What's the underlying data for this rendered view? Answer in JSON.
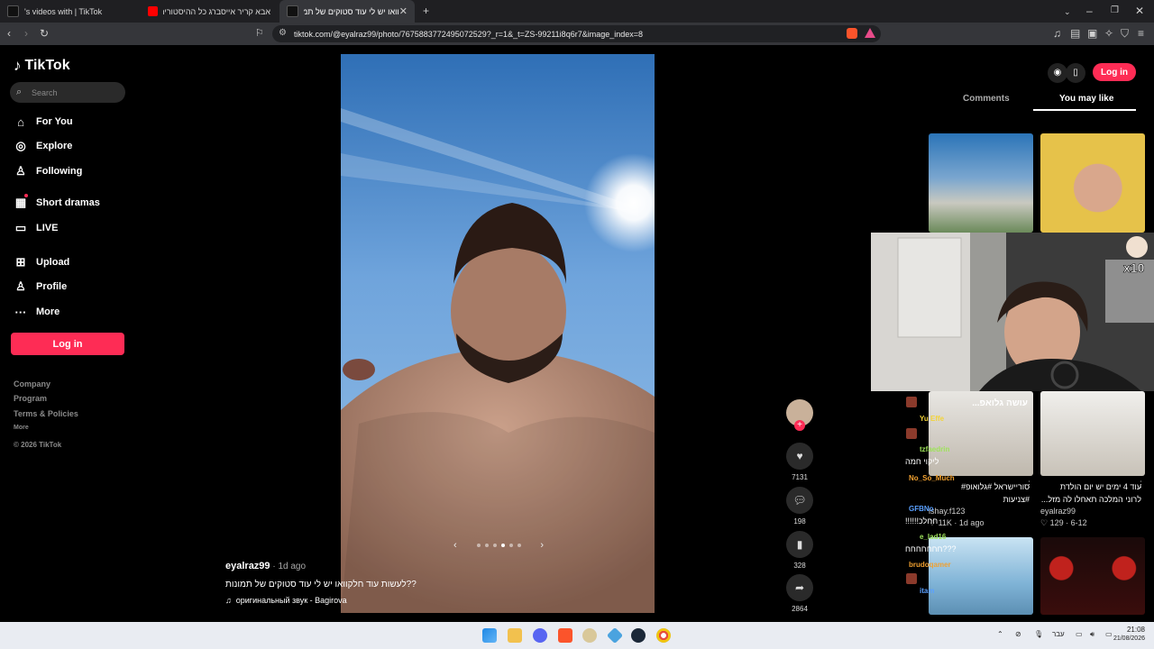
{
  "browser": {
    "tabs": [
      {
        "title": "'s videos with | TikTok",
        "active": false
      },
      {
        "title": "אבא קריר אייסברג כל ההיסטוריה (ה",
        "active": false
      },
      {
        "title": "וואו יש לי עוד סטוקים של תמונות",
        "active": true
      }
    ],
    "new_tab": "+",
    "url": "tiktok.com/@eyalraz99/photo/7675883772495072529?_r=1&_t=ZS-99211i8q6r7&image_index=8"
  },
  "sidebar": {
    "brand": "TikTok",
    "search_placeholder": "Search",
    "nav": [
      {
        "label": "For You",
        "icon": "home-icon"
      },
      {
        "label": "Explore",
        "icon": "compass-icon"
      },
      {
        "label": "Following",
        "icon": "following-icon"
      },
      {
        "label": "Short dramas",
        "icon": "drama-icon"
      },
      {
        "label": "LIVE",
        "icon": "live-icon"
      },
      {
        "label": "Upload",
        "icon": "upload-icon"
      },
      {
        "label": "Profile",
        "icon": "profile-icon"
      },
      {
        "label": "More",
        "icon": "more-icon"
      }
    ],
    "login_label": "Log in",
    "footer": {
      "company": "Company",
      "program": "Program",
      "terms": "Terms & Policies",
      "more": "More",
      "copyright": "© 2026 TikTok"
    }
  },
  "post": {
    "username": "eyalraz99",
    "time": "1d ago",
    "caption": "לעשות עוד חלקוואו יש לי עוד סטוקים של תמונות??",
    "sound": "оригинальный звук - Bagirova",
    "likes": "7131",
    "comments": "198",
    "saves": "328",
    "shares": "2864",
    "carousel_dots": 6,
    "carousel_active": 3
  },
  "header_right": {
    "login_label": "Log in"
  },
  "right_panel": {
    "tabs": [
      "Comments",
      "You may like"
    ],
    "active_tab": "You may like",
    "cards": [
      {
        "overlay": "עושה גלואפ...",
        "caption": "סוריישראל #גלואופ#\n#צניעות",
        "author": "ishay.f123",
        "stats": "11K · 1d ago"
      },
      {
        "overlay": "",
        "caption": "עוד 4 ימים יש יום הולדת\nלרוני המלכה תאחלו לה מזל...",
        "author": "eyalraz99",
        "stats": "129 · 6-12"
      }
    ]
  },
  "chat": [
    {
      "name": "Yu Effe",
      "msg": "",
      "color": "#f3d43a"
    },
    {
      "name": "tzfaedrin",
      "msg": "ליקוי חמה",
      "color": "#9ee35a"
    },
    {
      "name": "No_So_Much",
      "msg": "",
      "color": "#f0a030"
    },
    {
      "name": "GFBNo",
      "msg": "!!!!!!חחלכ",
      "color": "#5aa0ff"
    },
    {
      "name": "e_lad16",
      "msg": "חחחחחחח???",
      "color": "#9ee35a"
    },
    {
      "name": "brudoqamer",
      "msg": "",
      "color": "#f0a030"
    },
    {
      "name": "itam",
      "msg": "",
      "color": "#5aa0ff"
    }
  ],
  "taskbar": {
    "lang": "עבר",
    "time": "21:08",
    "date": "21/08/2026"
  },
  "colors": {
    "accent": "#fe2c55",
    "bg": "#000000",
    "chrome": "#35363a"
  }
}
